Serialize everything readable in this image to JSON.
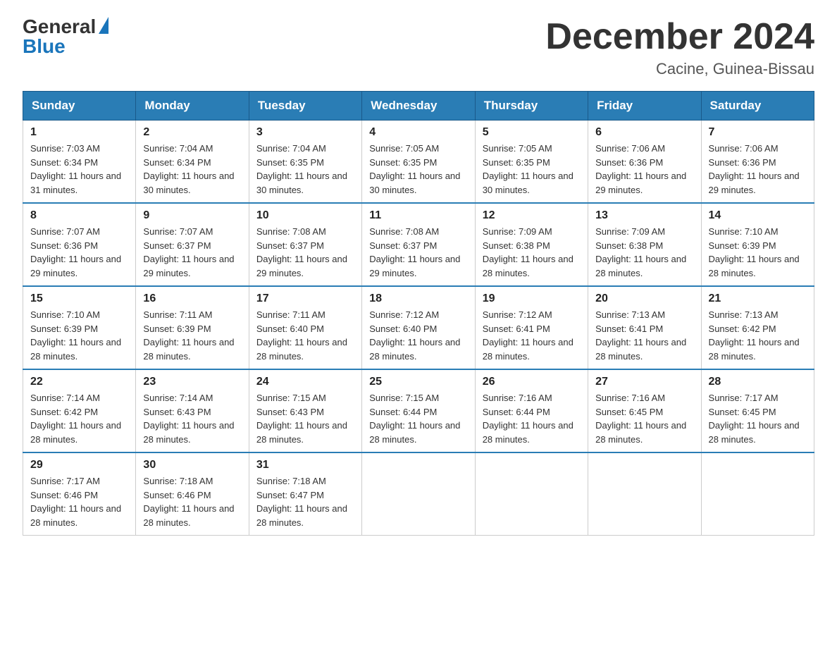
{
  "header": {
    "logo_general": "General",
    "logo_blue": "Blue",
    "main_title": "December 2024",
    "subtitle": "Cacine, Guinea-Bissau"
  },
  "days_of_week": [
    "Sunday",
    "Monday",
    "Tuesday",
    "Wednesday",
    "Thursday",
    "Friday",
    "Saturday"
  ],
  "weeks": [
    [
      {
        "day": "1",
        "sunrise": "7:03 AM",
        "sunset": "6:34 PM",
        "daylight": "11 hours and 31 minutes."
      },
      {
        "day": "2",
        "sunrise": "7:04 AM",
        "sunset": "6:34 PM",
        "daylight": "11 hours and 30 minutes."
      },
      {
        "day": "3",
        "sunrise": "7:04 AM",
        "sunset": "6:35 PM",
        "daylight": "11 hours and 30 minutes."
      },
      {
        "day": "4",
        "sunrise": "7:05 AM",
        "sunset": "6:35 PM",
        "daylight": "11 hours and 30 minutes."
      },
      {
        "day": "5",
        "sunrise": "7:05 AM",
        "sunset": "6:35 PM",
        "daylight": "11 hours and 30 minutes."
      },
      {
        "day": "6",
        "sunrise": "7:06 AM",
        "sunset": "6:36 PM",
        "daylight": "11 hours and 29 minutes."
      },
      {
        "day": "7",
        "sunrise": "7:06 AM",
        "sunset": "6:36 PM",
        "daylight": "11 hours and 29 minutes."
      }
    ],
    [
      {
        "day": "8",
        "sunrise": "7:07 AM",
        "sunset": "6:36 PM",
        "daylight": "11 hours and 29 minutes."
      },
      {
        "day": "9",
        "sunrise": "7:07 AM",
        "sunset": "6:37 PM",
        "daylight": "11 hours and 29 minutes."
      },
      {
        "day": "10",
        "sunrise": "7:08 AM",
        "sunset": "6:37 PM",
        "daylight": "11 hours and 29 minutes."
      },
      {
        "day": "11",
        "sunrise": "7:08 AM",
        "sunset": "6:37 PM",
        "daylight": "11 hours and 29 minutes."
      },
      {
        "day": "12",
        "sunrise": "7:09 AM",
        "sunset": "6:38 PM",
        "daylight": "11 hours and 28 minutes."
      },
      {
        "day": "13",
        "sunrise": "7:09 AM",
        "sunset": "6:38 PM",
        "daylight": "11 hours and 28 minutes."
      },
      {
        "day": "14",
        "sunrise": "7:10 AM",
        "sunset": "6:39 PM",
        "daylight": "11 hours and 28 minutes."
      }
    ],
    [
      {
        "day": "15",
        "sunrise": "7:10 AM",
        "sunset": "6:39 PM",
        "daylight": "11 hours and 28 minutes."
      },
      {
        "day": "16",
        "sunrise": "7:11 AM",
        "sunset": "6:39 PM",
        "daylight": "11 hours and 28 minutes."
      },
      {
        "day": "17",
        "sunrise": "7:11 AM",
        "sunset": "6:40 PM",
        "daylight": "11 hours and 28 minutes."
      },
      {
        "day": "18",
        "sunrise": "7:12 AM",
        "sunset": "6:40 PM",
        "daylight": "11 hours and 28 minutes."
      },
      {
        "day": "19",
        "sunrise": "7:12 AM",
        "sunset": "6:41 PM",
        "daylight": "11 hours and 28 minutes."
      },
      {
        "day": "20",
        "sunrise": "7:13 AM",
        "sunset": "6:41 PM",
        "daylight": "11 hours and 28 minutes."
      },
      {
        "day": "21",
        "sunrise": "7:13 AM",
        "sunset": "6:42 PM",
        "daylight": "11 hours and 28 minutes."
      }
    ],
    [
      {
        "day": "22",
        "sunrise": "7:14 AM",
        "sunset": "6:42 PM",
        "daylight": "11 hours and 28 minutes."
      },
      {
        "day": "23",
        "sunrise": "7:14 AM",
        "sunset": "6:43 PM",
        "daylight": "11 hours and 28 minutes."
      },
      {
        "day": "24",
        "sunrise": "7:15 AM",
        "sunset": "6:43 PM",
        "daylight": "11 hours and 28 minutes."
      },
      {
        "day": "25",
        "sunrise": "7:15 AM",
        "sunset": "6:44 PM",
        "daylight": "11 hours and 28 minutes."
      },
      {
        "day": "26",
        "sunrise": "7:16 AM",
        "sunset": "6:44 PM",
        "daylight": "11 hours and 28 minutes."
      },
      {
        "day": "27",
        "sunrise": "7:16 AM",
        "sunset": "6:45 PM",
        "daylight": "11 hours and 28 minutes."
      },
      {
        "day": "28",
        "sunrise": "7:17 AM",
        "sunset": "6:45 PM",
        "daylight": "11 hours and 28 minutes."
      }
    ],
    [
      {
        "day": "29",
        "sunrise": "7:17 AM",
        "sunset": "6:46 PM",
        "daylight": "11 hours and 28 minutes."
      },
      {
        "day": "30",
        "sunrise": "7:18 AM",
        "sunset": "6:46 PM",
        "daylight": "11 hours and 28 minutes."
      },
      {
        "day": "31",
        "sunrise": "7:18 AM",
        "sunset": "6:47 PM",
        "daylight": "11 hours and 28 minutes."
      },
      null,
      null,
      null,
      null
    ]
  ]
}
